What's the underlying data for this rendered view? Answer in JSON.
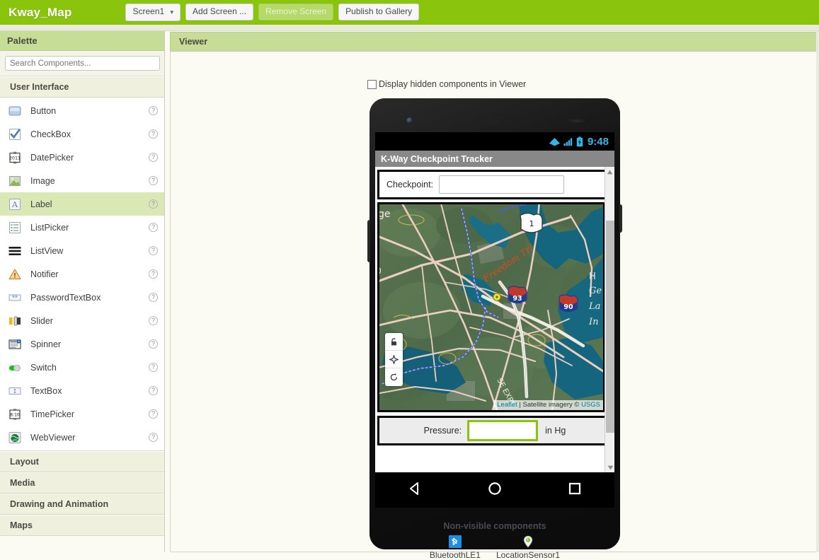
{
  "topbar": {
    "project_title": "Kway_Map",
    "buttons": [
      {
        "label": "Screen1",
        "name": "screen-selector",
        "caret": "▾",
        "disabled": false
      },
      {
        "label": "Add Screen ...",
        "name": "add-screen-button",
        "disabled": false
      },
      {
        "label": "Remove Screen",
        "name": "remove-screen-button",
        "disabled": true
      },
      {
        "label": "Publish to Gallery",
        "name": "publish-to-gallery-button",
        "disabled": false
      }
    ],
    "accent_color": "#8ac40d"
  },
  "palette": {
    "header": "Palette",
    "search_placeholder": "Search Components...",
    "search_value": "",
    "categories": [
      {
        "label": "User Interface",
        "expanded": true
      },
      {
        "label": "Layout",
        "expanded": false
      },
      {
        "label": "Media",
        "expanded": false
      },
      {
        "label": "Drawing and Animation",
        "expanded": false
      },
      {
        "label": "Maps",
        "expanded": false
      }
    ],
    "help_glyph": "?",
    "components": [
      {
        "label": "Button",
        "icon": "button-icon",
        "selected": false
      },
      {
        "label": "CheckBox",
        "icon": "checkbox-icon",
        "selected": false
      },
      {
        "label": "DatePicker",
        "icon": "datepicker-icon",
        "selected": false
      },
      {
        "label": "Image",
        "icon": "image-icon",
        "selected": false
      },
      {
        "label": "Label",
        "icon": "label-icon",
        "selected": true
      },
      {
        "label": "ListPicker",
        "icon": "listpicker-icon",
        "selected": false
      },
      {
        "label": "ListView",
        "icon": "listview-icon",
        "selected": false
      },
      {
        "label": "Notifier",
        "icon": "notifier-icon",
        "selected": false
      },
      {
        "label": "PasswordTextBox",
        "icon": "passwordtextbox-icon",
        "selected": false
      },
      {
        "label": "Slider",
        "icon": "slider-icon",
        "selected": false
      },
      {
        "label": "Spinner",
        "icon": "spinner-icon",
        "selected": false
      },
      {
        "label": "Switch",
        "icon": "switch-icon",
        "selected": false
      },
      {
        "label": "TextBox",
        "icon": "textbox-icon",
        "selected": false
      },
      {
        "label": "TimePicker",
        "icon": "timepicker-icon",
        "selected": false
      },
      {
        "label": "WebViewer",
        "icon": "webviewer-icon",
        "selected": false
      }
    ]
  },
  "viewer": {
    "header": "Viewer",
    "hidden_components_label": "Display hidden components in Viewer",
    "hidden_components_checked": false
  },
  "phone": {
    "status_time": "9:48",
    "status_accent": "#33b5e5",
    "app_title": "K-Way Checkpoint Tracker",
    "checkpoint": {
      "label": "Checkpoint:",
      "value": "",
      "placeholder": ""
    },
    "pressure": {
      "label": "Pressure:",
      "value": "",
      "placeholder": "",
      "suffix": "in Hg",
      "accent_color": "#8ac40d"
    },
    "map": {
      "attribution_leaflet": "Leaflet",
      "attribution_separator": " | ",
      "attribution_text": "Satellite imagery © ",
      "attribution_source": "USGS",
      "labels": [
        {
          "text": "Freedom Trl",
          "kind": "trail"
        },
        {
          "text": "1",
          "kind": "us-route-shield"
        },
        {
          "text": "93",
          "kind": "interstate-shield"
        },
        {
          "text": "90",
          "kind": "interstate-shield"
        },
        {
          "text": "SE EXPY",
          "kind": "highway-label"
        },
        {
          "text": "ge",
          "kind": "clipped-place-label"
        },
        {
          "text": "RD",
          "kind": "clipped-road-label"
        },
        {
          "text": "H",
          "kind": "clipped-place-label"
        },
        {
          "text": "Ge",
          "kind": "clipped-place-label"
        },
        {
          "text": "La",
          "kind": "clipped-place-label"
        },
        {
          "text": "In",
          "kind": "clipped-place-label"
        }
      ],
      "controls": [
        {
          "name": "pan-lock-control",
          "glyph": "lock"
        },
        {
          "name": "center-location-control",
          "glyph": "crosshair"
        },
        {
          "name": "reset-rotation-control",
          "glyph": "rotate"
        }
      ]
    },
    "nav": [
      {
        "name": "nav-back-button",
        "glyph": "triangle"
      },
      {
        "name": "nav-home-button",
        "glyph": "circle"
      },
      {
        "name": "nav-recents-button",
        "glyph": "square"
      }
    ]
  },
  "nonvisible": {
    "title": "Non-visible components",
    "items": [
      {
        "label": "BluetoothLE1",
        "icon": "bluetooth-icon"
      },
      {
        "label": "LocationSensor1",
        "icon": "location-pin-icon"
      }
    ]
  }
}
